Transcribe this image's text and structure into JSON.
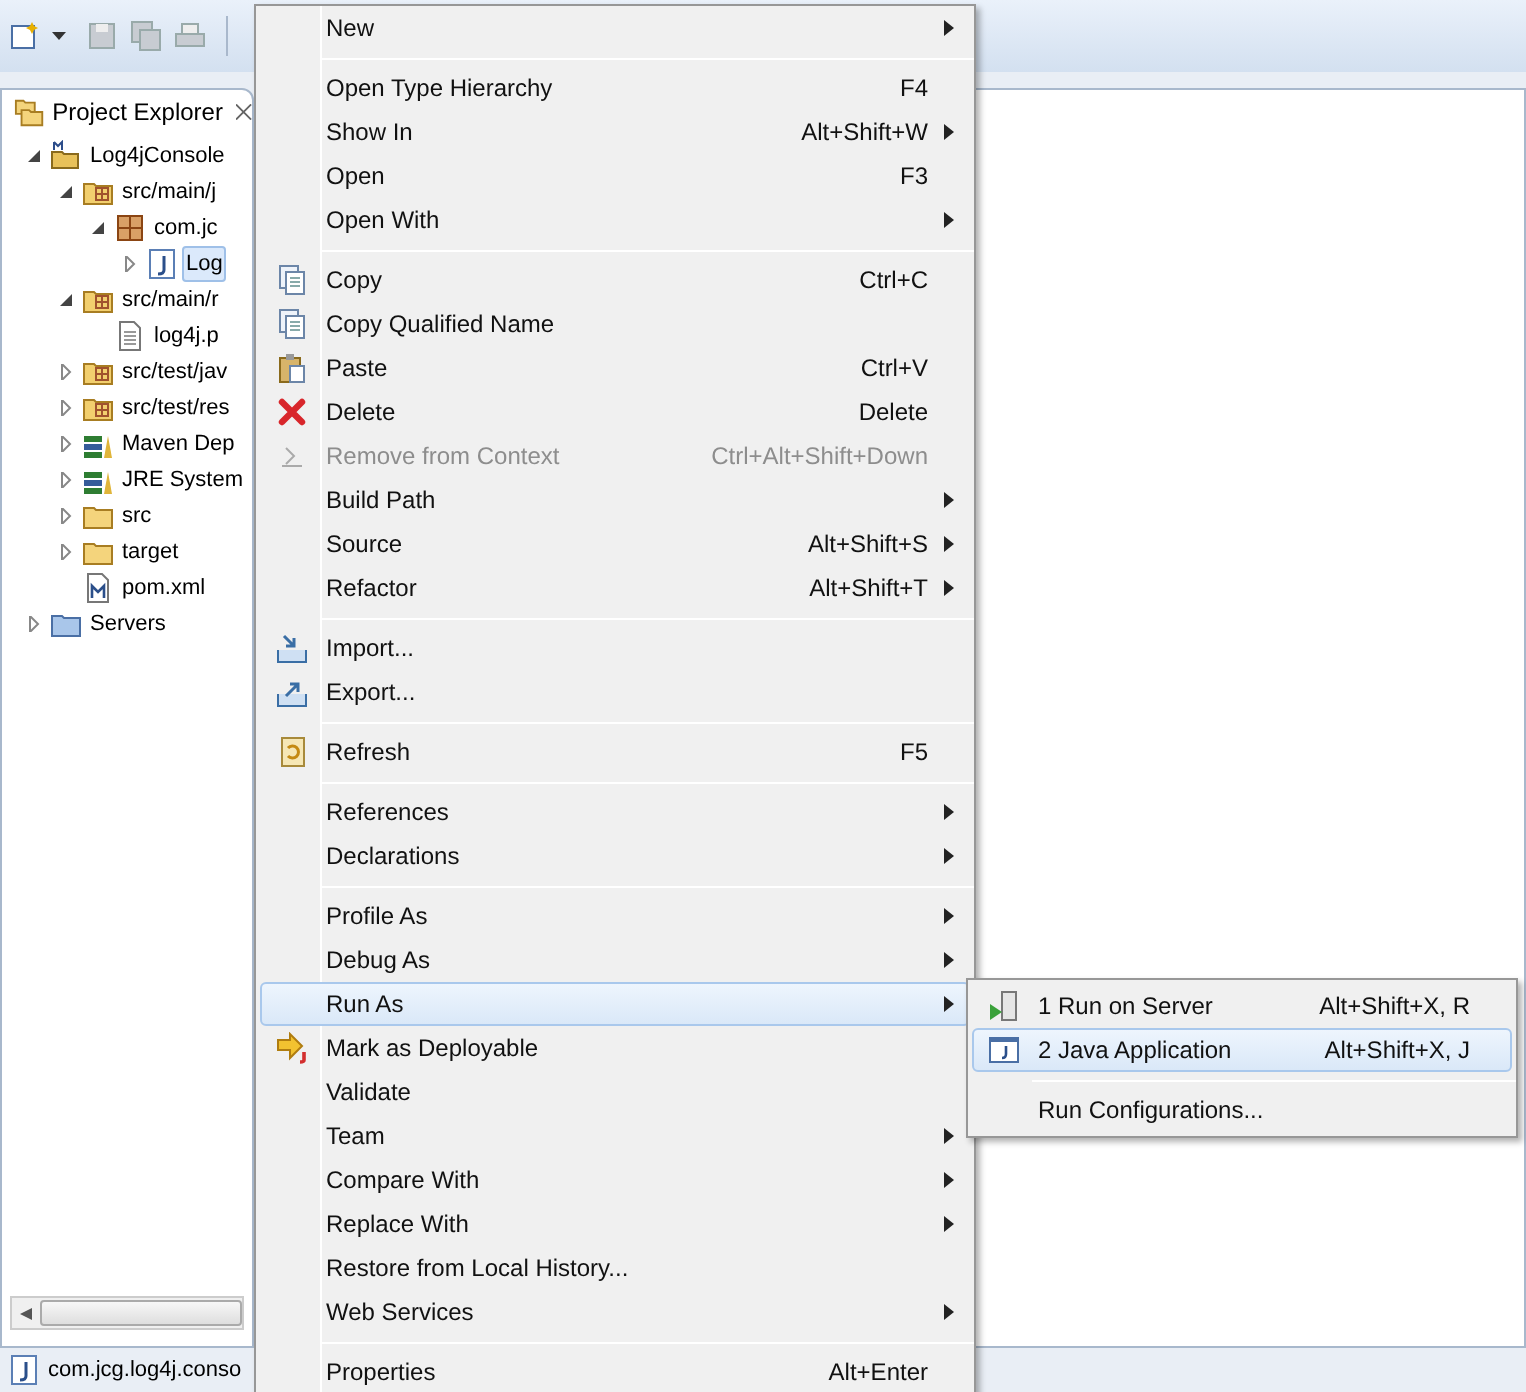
{
  "project_explorer": {
    "title": "Project Explorer",
    "tree": [
      {
        "label": "Log4jConsole",
        "kind": "project",
        "expanded": true,
        "selected": false,
        "children": [
          {
            "label": "src/main/j",
            "kind": "source-folder",
            "expanded": true,
            "selected": false,
            "children": [
              {
                "label": "com.jc",
                "kind": "package",
                "expanded": true,
                "selected": false,
                "children": [
                  {
                    "label": "Log",
                    "kind": "java-file",
                    "expanded": false,
                    "selected": true
                  }
                ]
              }
            ]
          },
          {
            "label": "src/main/r",
            "kind": "source-folder",
            "expanded": true,
            "selected": false,
            "children": [
              {
                "label": "log4j.p",
                "kind": "text-file",
                "selected": false
              }
            ]
          },
          {
            "label": "src/test/jav",
            "kind": "source-folder",
            "expanded": false,
            "selected": false
          },
          {
            "label": "src/test/res",
            "kind": "source-folder",
            "expanded": false,
            "selected": false
          },
          {
            "label": "Maven Dep",
            "kind": "library",
            "expanded": false,
            "selected": false
          },
          {
            "label": "JRE System",
            "kind": "library",
            "expanded": false,
            "selected": false
          },
          {
            "label": "src",
            "kind": "folder",
            "expanded": false,
            "selected": false
          },
          {
            "label": "target",
            "kind": "folder",
            "expanded": false,
            "selected": false
          },
          {
            "label": "pom.xml",
            "kind": "xml-file",
            "selected": false
          }
        ]
      },
      {
        "label": "Servers",
        "kind": "servers-folder",
        "expanded": false,
        "selected": false
      }
    ]
  },
  "context_menu": {
    "items": [
      {
        "kind": "plain",
        "label": "New",
        "submenu": true,
        "disabled": false,
        "selected": false
      },
      {
        "kind": "separator"
      },
      {
        "kind": "plain",
        "label": "Open Type Hierarchy",
        "shortcut": "F4",
        "submenu": false,
        "disabled": false,
        "selected": false
      },
      {
        "kind": "plain",
        "label": "Show In",
        "shortcut": "Alt+Shift+W",
        "submenu": true,
        "disabled": false,
        "selected": false
      },
      {
        "kind": "plain",
        "label": "Open",
        "shortcut": "F3",
        "submenu": false,
        "disabled": false,
        "selected": false
      },
      {
        "kind": "plain",
        "label": "Open With",
        "submenu": true,
        "disabled": false,
        "selected": false
      },
      {
        "kind": "separator"
      },
      {
        "kind": "copy",
        "label": "Copy",
        "shortcut": "Ctrl+C",
        "submenu": false,
        "disabled": false,
        "selected": false
      },
      {
        "kind": "copy",
        "label": "Copy Qualified Name",
        "submenu": false,
        "disabled": false,
        "selected": false
      },
      {
        "kind": "paste",
        "label": "Paste",
        "shortcut": "Ctrl+V",
        "submenu": false,
        "disabled": false,
        "selected": false
      },
      {
        "kind": "delete",
        "label": "Delete",
        "shortcut": "Delete",
        "submenu": false,
        "disabled": false,
        "selected": false
      },
      {
        "kind": "remove",
        "label": "Remove from Context",
        "shortcut": "Ctrl+Alt+Shift+Down",
        "submenu": false,
        "disabled": true,
        "selected": false
      },
      {
        "kind": "plain",
        "label": "Build Path",
        "submenu": true,
        "disabled": false,
        "selected": false
      },
      {
        "kind": "plain",
        "label": "Source",
        "shortcut": "Alt+Shift+S",
        "submenu": true,
        "disabled": false,
        "selected": false
      },
      {
        "kind": "plain",
        "label": "Refactor",
        "shortcut": "Alt+Shift+T",
        "submenu": true,
        "disabled": false,
        "selected": false
      },
      {
        "kind": "separator"
      },
      {
        "kind": "import",
        "label": "Import...",
        "submenu": false,
        "disabled": false,
        "selected": false
      },
      {
        "kind": "export",
        "label": "Export...",
        "submenu": false,
        "disabled": false,
        "selected": false
      },
      {
        "kind": "separator"
      },
      {
        "kind": "refresh",
        "label": "Refresh",
        "shortcut": "F5",
        "submenu": false,
        "disabled": false,
        "selected": false
      },
      {
        "kind": "separator"
      },
      {
        "kind": "plain",
        "label": "References",
        "submenu": true,
        "disabled": false,
        "selected": false
      },
      {
        "kind": "plain",
        "label": "Declarations",
        "submenu": true,
        "disabled": false,
        "selected": false
      },
      {
        "kind": "separator"
      },
      {
        "kind": "plain",
        "label": "Profile As",
        "submenu": true,
        "disabled": false,
        "selected": false
      },
      {
        "kind": "plain",
        "label": "Debug As",
        "submenu": true,
        "disabled": false,
        "selected": false
      },
      {
        "kind": "plain",
        "label": "Run As",
        "submenu": true,
        "disabled": false,
        "selected": true
      },
      {
        "kind": "deploy",
        "label": "Mark as Deployable",
        "submenu": false,
        "disabled": false,
        "selected": false
      },
      {
        "kind": "plain",
        "label": "Validate",
        "submenu": false,
        "disabled": false,
        "selected": false
      },
      {
        "kind": "plain",
        "label": "Team",
        "submenu": true,
        "disabled": false,
        "selected": false
      },
      {
        "kind": "plain",
        "label": "Compare With",
        "submenu": true,
        "disabled": false,
        "selected": false
      },
      {
        "kind": "plain",
        "label": "Replace With",
        "submenu": true,
        "disabled": false,
        "selected": false
      },
      {
        "kind": "plain",
        "label": "Restore from Local History...",
        "submenu": false,
        "disabled": false,
        "selected": false
      },
      {
        "kind": "plain",
        "label": "Web Services",
        "submenu": true,
        "disabled": false,
        "selected": false
      },
      {
        "kind": "separator"
      },
      {
        "kind": "plain",
        "label": "Properties",
        "shortcut": "Alt+Enter",
        "submenu": false,
        "disabled": false,
        "selected": false
      }
    ]
  },
  "run_as_submenu": {
    "items": [
      {
        "kind": "server",
        "label": "1 Run on Server",
        "shortcut": "Alt+Shift+X, R",
        "selected": false
      },
      {
        "kind": "java-app",
        "label": "2 Java Application",
        "shortcut": "Alt+Shift+X, J",
        "selected": true
      },
      {
        "kind": "separator"
      },
      {
        "kind": "plain",
        "label": "Run Configurations...",
        "selected": false
      }
    ]
  },
  "status_bar": {
    "text": "com.jcg.log4j.conso"
  }
}
